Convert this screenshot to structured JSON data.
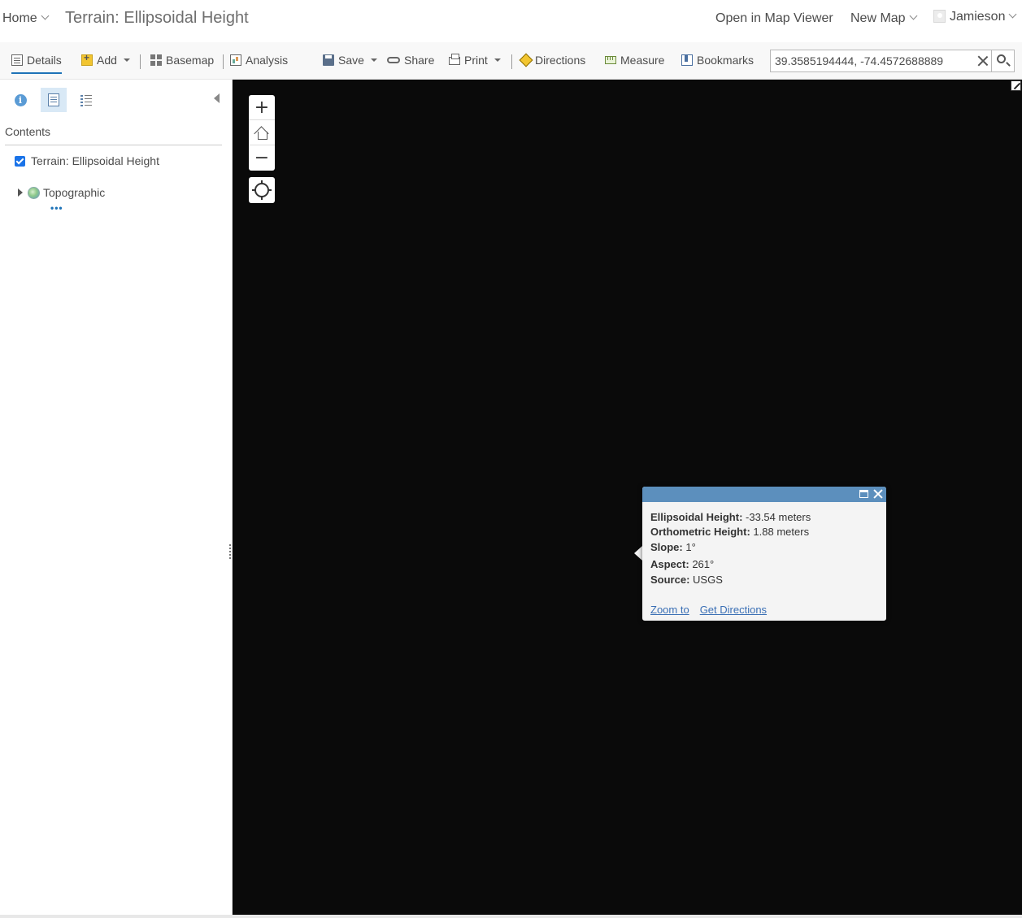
{
  "header": {
    "home_label": "Home",
    "title": "Terrain: Ellipsoidal Height",
    "open_viewer_label": "Open in Map Viewer",
    "new_map_label": "New Map",
    "user_name": "Jamieson"
  },
  "toolbar": {
    "details_label": "Details",
    "add_label": "Add",
    "basemap_label": "Basemap",
    "analysis_label": "Analysis",
    "save_label": "Save",
    "share_label": "Share",
    "print_label": "Print",
    "directions_label": "Directions",
    "measure_label": "Measure",
    "bookmarks_label": "Bookmarks"
  },
  "search": {
    "value": "39.3585194444, -74.4572688889"
  },
  "left_panel": {
    "contents_heading": "Contents",
    "layer": {
      "name": "Terrain: Ellipsoidal Height",
      "checked": true
    },
    "basemap": {
      "name": "Topographic"
    },
    "more_label": "•••"
  },
  "map_controls": {
    "zoom_in": "+",
    "zoom_out": "−"
  },
  "popup": {
    "fields": [
      {
        "label": "Ellipsoidal Height:",
        "value": "-33.54 meters"
      },
      {
        "label": "Orthometric Height:",
        "value": "1.88 meters"
      },
      {
        "label": "Slope:",
        "value": "1°"
      },
      {
        "label": "Aspect:",
        "value": "261°"
      },
      {
        "label": "Source:",
        "value": "USGS"
      }
    ],
    "zoom_to_label": "Zoom to",
    "directions_label": "Get Directions"
  },
  "colors": {
    "accent": "#1e73b8",
    "popup_header": "#5c8fbd",
    "map_background": "#0a0a0a"
  }
}
